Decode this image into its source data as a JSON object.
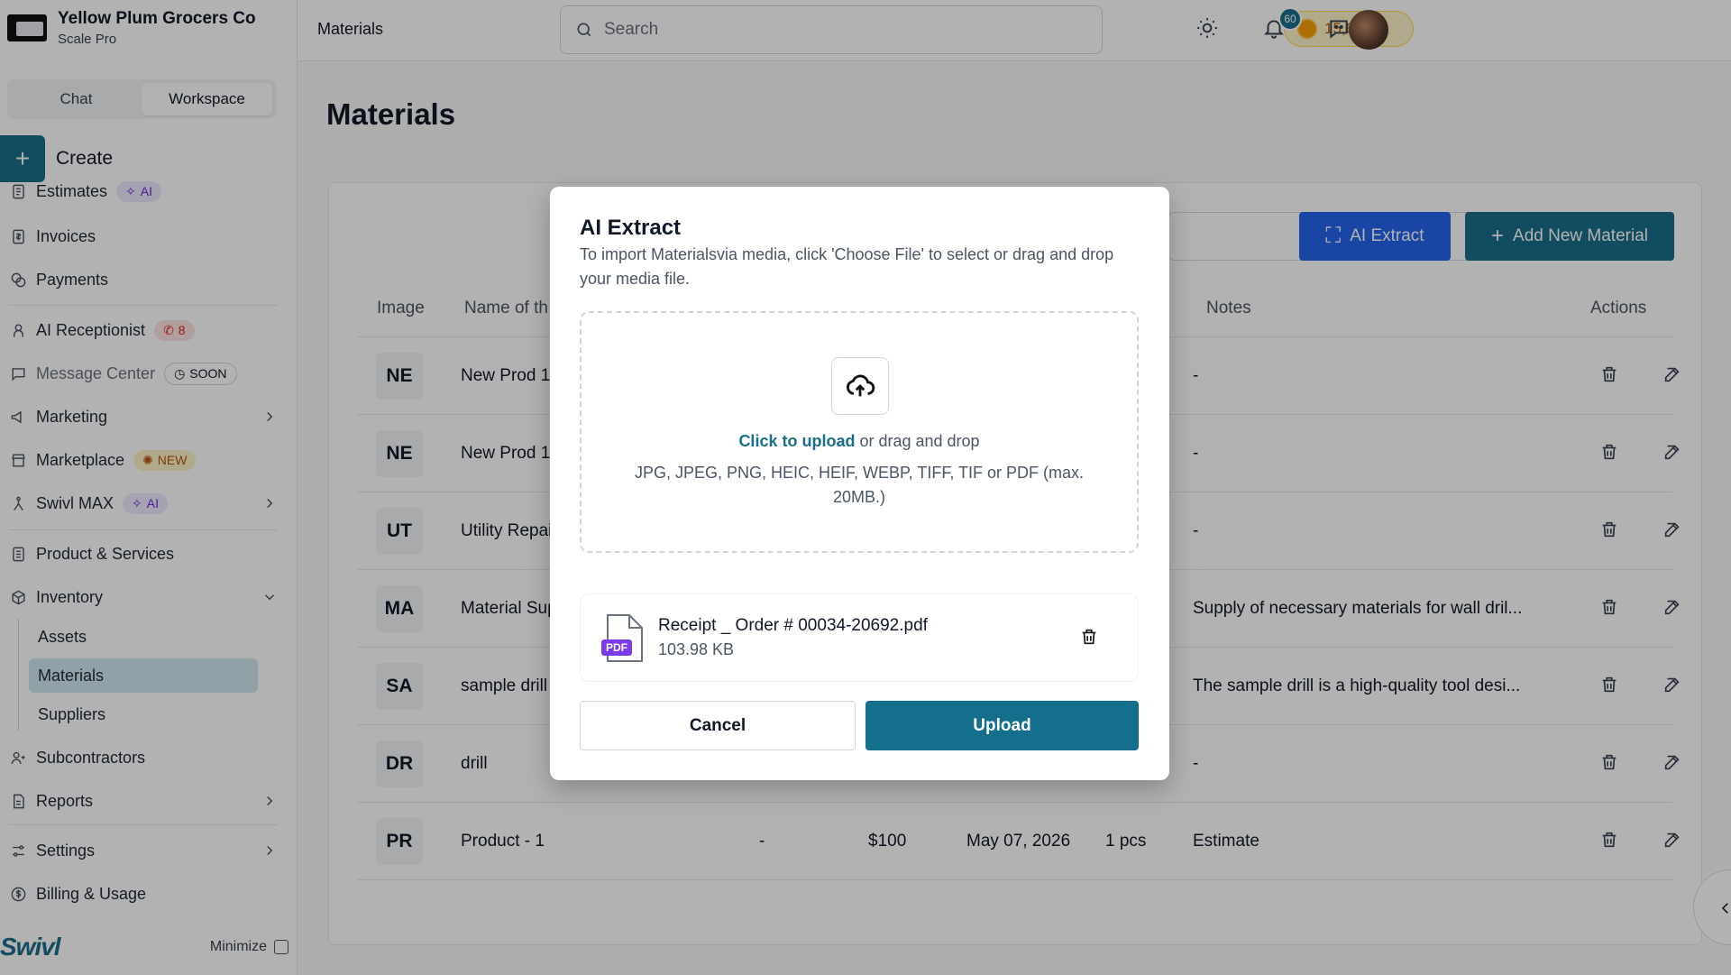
{
  "org": {
    "name": "Yellow Plum Grocers Co",
    "plan": "Scale Pro"
  },
  "mode_tabs": [
    {
      "label": "Chat"
    },
    {
      "label": "Workspace",
      "active": true
    }
  ],
  "create_label": "Create",
  "nav": {
    "estimates": {
      "label": "Estimates",
      "pill": "AI"
    },
    "invoices": {
      "label": "Invoices"
    },
    "payments": {
      "label": "Payments"
    },
    "ai_receptionist": {
      "label": "AI Receptionist",
      "pill": "8"
    },
    "message_center": {
      "label": "Message Center",
      "pill": "SOON"
    },
    "marketing": {
      "label": "Marketing"
    },
    "marketplace": {
      "label": "Marketplace",
      "pill": "NEW"
    },
    "swivl_max": {
      "label": "Swivl MAX",
      "pill": "AI"
    },
    "product_services": {
      "label": "Product & Services"
    },
    "inventory": {
      "label": "Inventory",
      "children": [
        "Assets",
        "Materials",
        "Suppliers"
      ]
    },
    "subcontractors": {
      "label": "Subcontractors"
    },
    "reports": {
      "label": "Reports"
    },
    "settings": {
      "label": "Settings"
    },
    "billing": {
      "label": "Billing & Usage"
    }
  },
  "brand": "Swivl",
  "minimize_label": "Minimize",
  "topbar": {
    "breadcrumb": "Materials",
    "search_placeholder": "Search",
    "credits": "15,650",
    "notification_count": "60"
  },
  "page": {
    "title": "Materials",
    "ai_extract_label": "AI Extract",
    "add_new_label": "Add New Material",
    "columns": {
      "image": "Image",
      "name": "Name of th",
      "notes": "Notes",
      "actions": "Actions"
    },
    "rows": [
      {
        "initials": "NE",
        "name": "New Prod 18",
        "c3": "",
        "price": "",
        "date": "",
        "qty": "",
        "notes": "-"
      },
      {
        "initials": "NE",
        "name": "New Prod 18",
        "c3": "",
        "price": "",
        "date": "",
        "qty": "",
        "notes": "-"
      },
      {
        "initials": "UT",
        "name": "Utility Repai",
        "c3": "",
        "price": "",
        "date": "",
        "qty": "",
        "notes": "-"
      },
      {
        "initials": "MA",
        "name": "Material Sup",
        "c3": "",
        "price": "",
        "date": "",
        "qty": "",
        "notes": "Supply of necessary materials for wall dril..."
      },
      {
        "initials": "SA",
        "name": "sample drill",
        "c3": "",
        "price": "",
        "date": "",
        "qty": "",
        "notes": "The sample drill is a high-quality tool desi..."
      },
      {
        "initials": "DR",
        "name": "drill",
        "c3": "",
        "price": "",
        "date": "",
        "qty": "",
        "notes": "-"
      },
      {
        "initials": "PR",
        "name": "Product - 1",
        "c3": "-",
        "price": "$100",
        "date": "May 07, 2026",
        "qty": "1 pcs",
        "notes": "Estimate"
      }
    ]
  },
  "modal": {
    "title": "AI Extract",
    "description": "To import Materialsvia media, click 'Choose File' to select or drag and drop your media file.",
    "upload_link": "Click to upload",
    "upload_rest": " or drag and drop",
    "formats": "JPG, JPEG, PNG, HEIC, HEIF, WEBP, TIFF, TIF or PDF (max. 20MB.)",
    "file": {
      "name": "Receipt _ Order # 00034-20692.pdf",
      "size": "103.98 KB",
      "type_label": "PDF"
    },
    "cancel_label": "Cancel",
    "upload_label": "Upload"
  },
  "colors": {
    "primary": "#1a6e8a",
    "ai_blue": "#2563eb",
    "active_nav": "#cfe8ef"
  }
}
